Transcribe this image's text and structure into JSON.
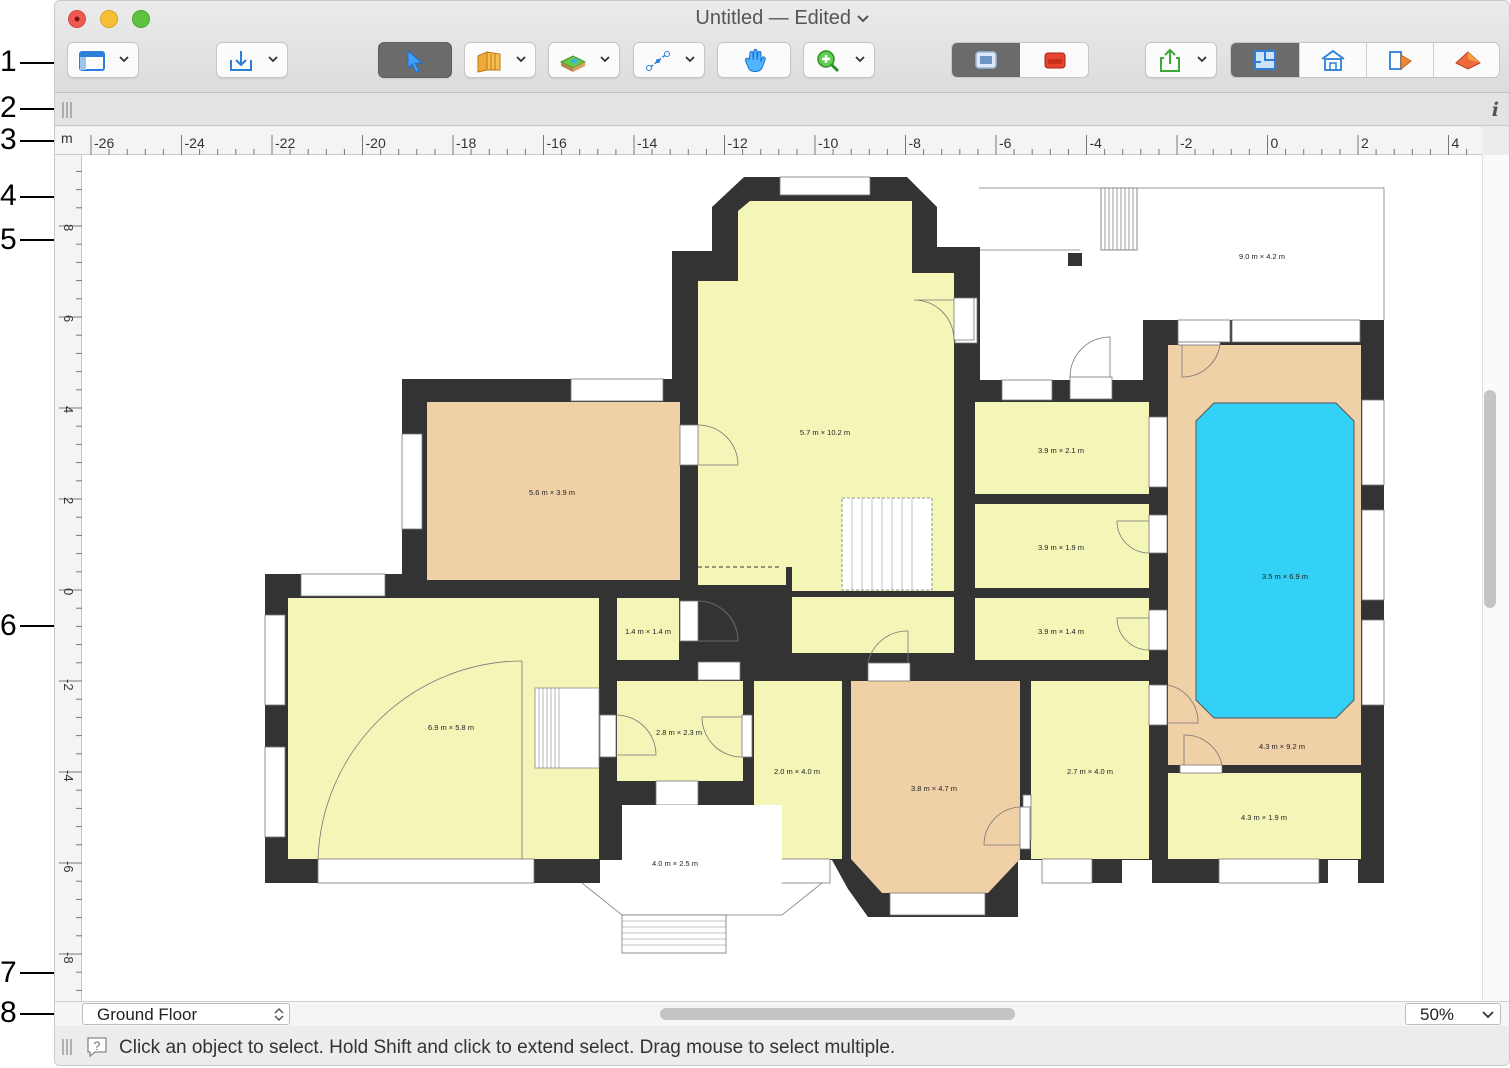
{
  "window": {
    "title": "Untitled — Edited"
  },
  "callouts": [
    "1",
    "2",
    "3",
    "4",
    "5",
    "6",
    "7",
    "8"
  ],
  "toolbar": {
    "buttons": [
      {
        "name": "view-options-button",
        "icon": "window-layout-icon"
      },
      {
        "name": "import-button",
        "icon": "import-tray-icon"
      },
      {
        "name": "select-tool-button",
        "icon": "arrow-pointer-icon"
      },
      {
        "name": "walls-tool-button",
        "icon": "walls-icon"
      },
      {
        "name": "terrain-tool-button",
        "icon": "terrain-icon"
      },
      {
        "name": "dimension-tool-button",
        "icon": "dimension-icon"
      },
      {
        "name": "pan-tool-button",
        "icon": "hand-icon"
      },
      {
        "name": "zoom-tool-button",
        "icon": "zoom-in-icon"
      },
      {
        "name": "library-toggle",
        "icon": "library-icon"
      },
      {
        "name": "furniture-toggle",
        "icon": "sofa-icon"
      },
      {
        "name": "share-button",
        "icon": "share-icon"
      },
      {
        "name": "view-2d-plan",
        "icon": "floorplan-icon"
      },
      {
        "name": "view-3d-house",
        "icon": "house-icon"
      },
      {
        "name": "view-elevation",
        "icon": "elevation-icon"
      },
      {
        "name": "view-3d-roof",
        "icon": "roof-icon"
      }
    ],
    "info_label": "i"
  },
  "ruler": {
    "unit": "m",
    "h_ticks": [
      "-26",
      "-24",
      "-22",
      "-20",
      "-18",
      "-16",
      "-14",
      "-12",
      "-10",
      "-8",
      "-6",
      "-4",
      "-2",
      "0",
      "2",
      "4"
    ],
    "v_ticks": [
      "8",
      "6",
      "4",
      "2",
      "0",
      "-2",
      "-4",
      "-6",
      "-8"
    ]
  },
  "floorplan": {
    "rooms": [
      {
        "label": "5.7 m × 10.2 m",
        "type": "yellow"
      },
      {
        "label": "9.0 m × 4.2 m",
        "type": "outdoor"
      },
      {
        "label": "5.6 m × 3.9 m",
        "type": "orange"
      },
      {
        "label": "3.9 m × 2.1 m",
        "type": "yellow"
      },
      {
        "label": "3.9 m × 1.9 m",
        "type": "yellow"
      },
      {
        "label": "3.9 m × 1.4 m",
        "type": "yellow"
      },
      {
        "label": "3.5 m × 6.9 m",
        "type": "pool"
      },
      {
        "label": "4.3 m × 9.2 m",
        "type": "orange"
      },
      {
        "label": "1.4 m × 1.4 m",
        "type": "yellow"
      },
      {
        "label": "6.9 m × 5.8 m",
        "type": "yellow"
      },
      {
        "label": "2.8 m × 2.3 m",
        "type": "yellow"
      },
      {
        "label": "2.0 m × 4.0 m",
        "type": "yellow"
      },
      {
        "label": "3.8 m × 4.7 m",
        "type": "orange"
      },
      {
        "label": "2.7 m × 4.0 m",
        "type": "yellow"
      },
      {
        "label": "4.3 m × 1.9 m",
        "type": "yellow"
      },
      {
        "label": "4.0 m × 2.5 m",
        "type": "outdoor"
      }
    ]
  },
  "bottombar": {
    "floor": "Ground Floor",
    "zoom": "50%"
  },
  "status": {
    "text": "Click an object to select. Hold Shift and click to extend select. Drag mouse to select multiple."
  },
  "colors": {
    "wall": "#333333",
    "room_yellow": "#f4f6b8",
    "room_orange": "#f0d0a6",
    "pool": "#33d1f5",
    "accent_active": "#6b6b6b",
    "close": "#ee5a52",
    "minimize": "#f5be34",
    "zoom": "#5ec440"
  }
}
